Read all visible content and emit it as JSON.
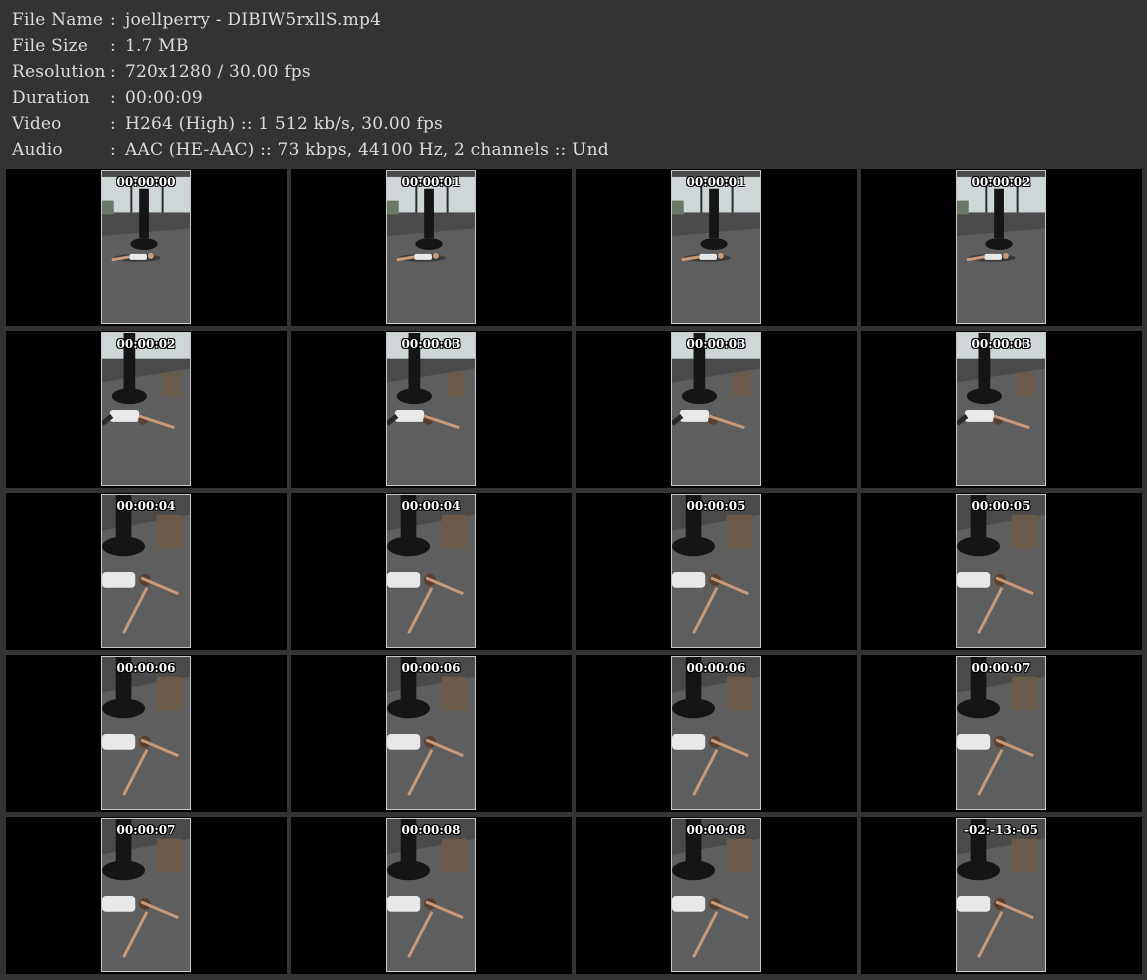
{
  "file_info": [
    {
      "label": "File Name",
      "value": "joellperry - DIBIW5rxllS.mp4"
    },
    {
      "label": "File Size",
      "value": "1.7 MB"
    },
    {
      "label": "Resolution",
      "value": "720x1280 / 30.00 fps"
    },
    {
      "label": "Duration",
      "value": "00:00:09"
    },
    {
      "label": "Video",
      "value": "H264 (High) :: 1 512 kb/s, 30.00 fps"
    },
    {
      "label": "Audio",
      "value": "AAC (HE-AAC) :: 73 kbps, 44100 Hz, 2 channels :: Und"
    }
  ],
  "separator": ":",
  "thumbnails": [
    {
      "timestamp": "00:00:00",
      "scene": "wide"
    },
    {
      "timestamp": "00:00:01",
      "scene": "wide"
    },
    {
      "timestamp": "00:00:01",
      "scene": "wide"
    },
    {
      "timestamp": "00:00:02",
      "scene": "wide"
    },
    {
      "timestamp": "00:00:02",
      "scene": "mid"
    },
    {
      "timestamp": "00:00:03",
      "scene": "mid"
    },
    {
      "timestamp": "00:00:03",
      "scene": "mid"
    },
    {
      "timestamp": "00:00:03",
      "scene": "mid"
    },
    {
      "timestamp": "00:00:04",
      "scene": "close"
    },
    {
      "timestamp": "00:00:04",
      "scene": "close"
    },
    {
      "timestamp": "00:00:05",
      "scene": "close"
    },
    {
      "timestamp": "00:00:05",
      "scene": "close"
    },
    {
      "timestamp": "00:00:06",
      "scene": "close"
    },
    {
      "timestamp": "00:00:06",
      "scene": "close"
    },
    {
      "timestamp": "00:00:06",
      "scene": "close"
    },
    {
      "timestamp": "00:00:07",
      "scene": "close"
    },
    {
      "timestamp": "00:00:07",
      "scene": "close"
    },
    {
      "timestamp": "00:00:08",
      "scene": "close"
    },
    {
      "timestamp": "00:00:08",
      "scene": "close"
    },
    {
      "timestamp": "-02:-13:-05",
      "scene": "close"
    }
  ],
  "colors": {
    "background": "#333333",
    "text": "#dcdcdc",
    "cell": "#000000",
    "thumb_border": "#c8c8c8",
    "floor": "#5e5e5e",
    "wall": "#4a4a4a",
    "window": "#cfd6d8",
    "bag": "#151515",
    "shirt": "#e8e8e8",
    "skin": "#c99a7a"
  }
}
